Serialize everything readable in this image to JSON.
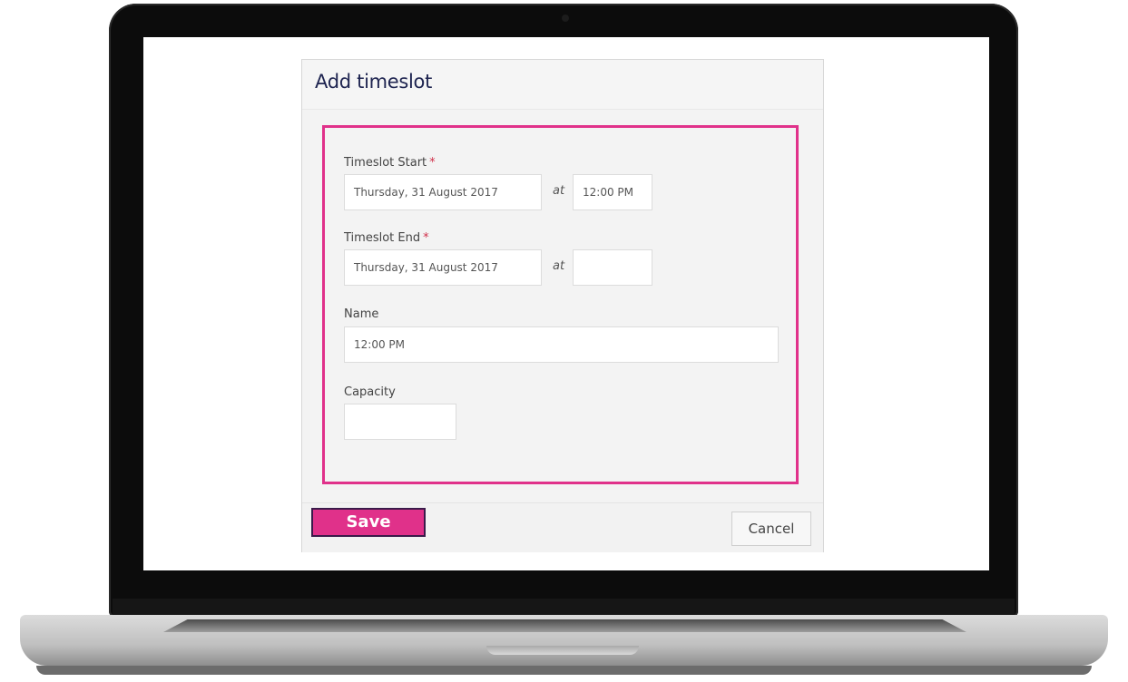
{
  "dialog": {
    "title": "Add timeslot",
    "timeslot_start": {
      "label": "Timeslot Start",
      "required_marker": "*",
      "date_value": "Thursday, 31 August 2017",
      "at_label": "at",
      "time_value": "12:00 PM"
    },
    "timeslot_end": {
      "label": "Timeslot End",
      "required_marker": "*",
      "date_value": "Thursday, 31 August 2017",
      "at_label": "at",
      "time_value": ""
    },
    "name": {
      "label": "Name",
      "value": "12:00 PM"
    },
    "capacity": {
      "label": "Capacity",
      "value": ""
    },
    "save_label": "Save",
    "cancel_label": "Cancel"
  },
  "colors": {
    "accent": "#e0318a",
    "title": "#1e2450",
    "required": "#d0304a"
  }
}
